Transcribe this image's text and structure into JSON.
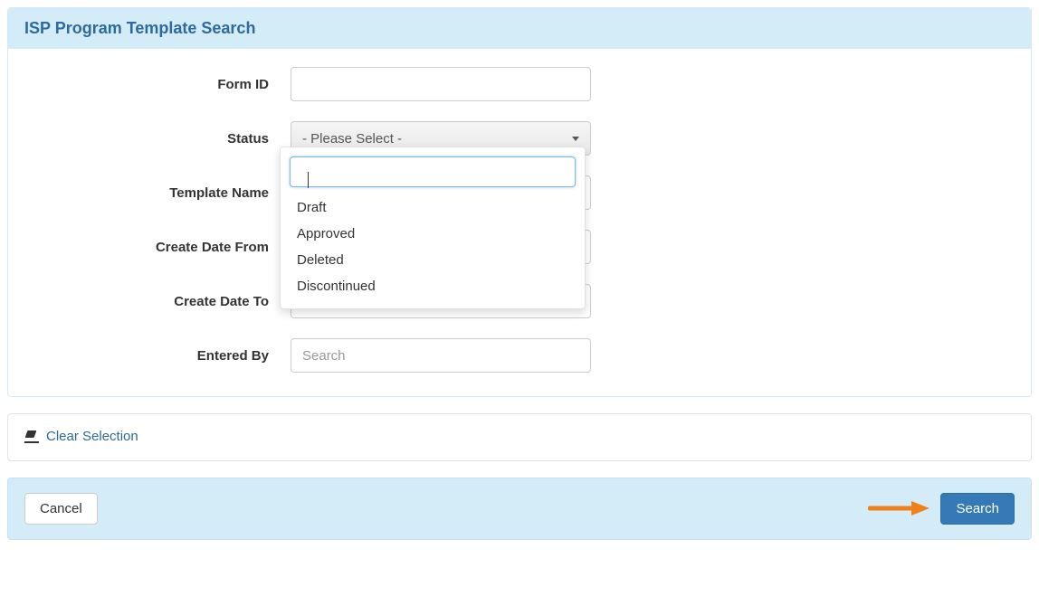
{
  "panel": {
    "title": "ISP Program Template Search"
  },
  "form": {
    "form_id": {
      "label": "Form ID",
      "value": ""
    },
    "status": {
      "label": "Status",
      "selected": "- Please Select -"
    },
    "template_name": {
      "label": "Template Name",
      "value": ""
    },
    "create_date_from": {
      "label": "Create Date From",
      "value": ""
    },
    "create_date_to": {
      "label": "Create Date To",
      "value": ""
    },
    "entered_by": {
      "label": "Entered By",
      "value": "",
      "placeholder": "Search"
    }
  },
  "status_dropdown": {
    "search_value": "",
    "options": [
      "Draft",
      "Approved",
      "Deleted",
      "Discontinued"
    ]
  },
  "clear": {
    "label": "Clear Selection"
  },
  "actions": {
    "cancel": "Cancel",
    "search": "Search"
  },
  "annotation": {
    "arrow_color": "#f08018"
  }
}
